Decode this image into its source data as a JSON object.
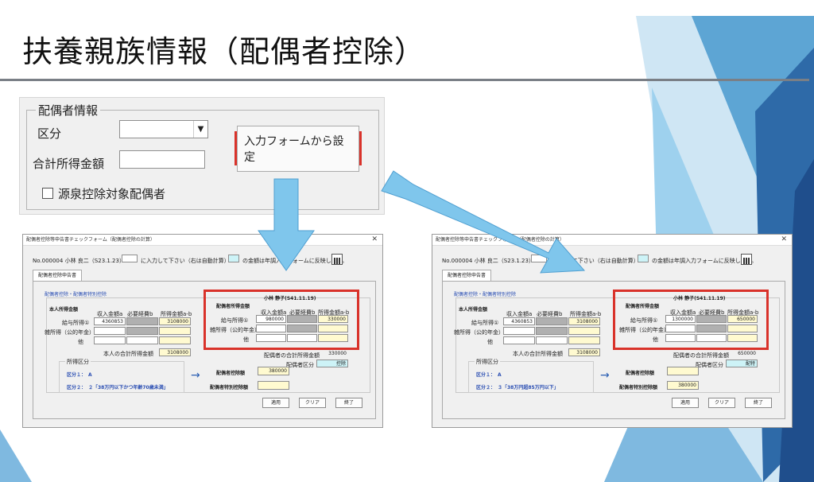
{
  "title": "扶養親族情報（配偶者控除）",
  "colors": {
    "accent_red": "#d9322a",
    "arrow_blue": "#7fc6ec",
    "deco_blue": "#1f4e8c"
  },
  "spouse_panel": {
    "legend": "配偶者情報",
    "kubun_label": "区分",
    "income_label": "合計所得金額",
    "gensen_label": "源泉控除対象配偶者",
    "set_button": "入力フォームから設定"
  },
  "windows": [
    {
      "title": "配偶者控除等申告書チェックフォーム（配偶者控除の計算）",
      "employee": "No.000004 小林 良二（S23.1.23）",
      "hint1": "に入力して下さい（右は自動計算）",
      "hint2": "の金額は年調入力フォームに反映します。",
      "tab": "配偶者控除申告書",
      "subtitle": "配偶者控除・配偶者特別控除",
      "self_section": "本人所得金額",
      "col_revenue": "収入金額a",
      "col_expense": "必要経費b",
      "col_income": "所得金額a-b",
      "row_salary": "給与所得①",
      "row_misc": "雑所得（公的年金）",
      "row_other": "他",
      "self_revenue": "4360853",
      "self_income": "3108000",
      "self_total_label": "本人の合計所得金額",
      "self_total": "3108000",
      "spouse_name": "小林 静子(S41.11.19)",
      "spouse_section": "配偶者所得金額",
      "spouse_revenue": "980000",
      "spouse_income": "330000",
      "spouse_total_label": "配偶者の合計所得金額",
      "spouse_total": "330000",
      "spouse_kubun_label": "配偶者区分",
      "spouse_kubun": "控除",
      "kubun_title": "所得区分",
      "kubun1": "区分１：　A",
      "kubun2": "区分２：　２「38万円以下かつ年齢70歳未満」",
      "deduction_label": "配偶者控除額",
      "deduction": "380000",
      "special_label": "配偶者特別控除額",
      "special": "",
      "btn_apply": "適用",
      "btn_clear": "クリア",
      "btn_exit": "終了"
    },
    {
      "title": "配偶者控除等申告書チェックフォーム（配偶者控除の計算）",
      "employee": "No.000004 小林 良二（S23.1.23）",
      "hint1": "に入力して下さい（右は自動計算）",
      "hint2": "の金額は年調入力フォームに反映します。",
      "tab": "配偶者控除申告書",
      "subtitle": "配偶者控除・配偶者特別控除",
      "self_section": "本人所得金額",
      "col_revenue": "収入金額a",
      "col_expense": "必要経費b",
      "col_income": "所得金額a-b",
      "row_salary": "給与所得①",
      "row_misc": "雑所得（公的年金）",
      "row_other": "他",
      "self_revenue": "4360853",
      "self_income": "3108000",
      "self_total_label": "本人の合計所得金額",
      "self_total": "3108000",
      "spouse_name": "小林 静子(S41.11.19)",
      "spouse_section": "配偶者所得金額",
      "spouse_revenue": "1300000",
      "spouse_income": "650000",
      "spouse_total_label": "配偶者の合計所得金額",
      "spouse_total": "650000",
      "spouse_kubun_label": "配偶者区分",
      "spouse_kubun": "配特",
      "kubun_title": "所得区分",
      "kubun1": "区分１：　A",
      "kubun2": "区分２：　３「38万円超85万円以下」",
      "deduction_label": "配偶者控除額",
      "deduction": "",
      "special_label": "配偶者特別控除額",
      "special": "380000",
      "btn_apply": "適用",
      "btn_clear": "クリア",
      "btn_exit": "終了"
    }
  ]
}
